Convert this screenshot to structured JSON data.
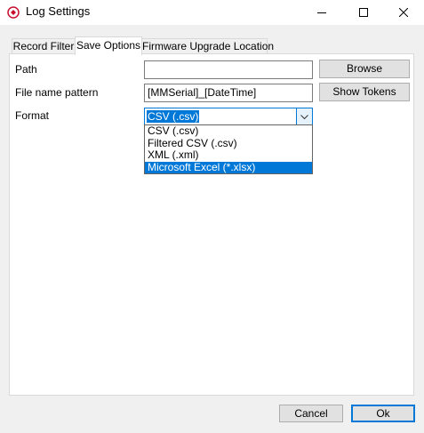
{
  "window": {
    "title": "Log Settings",
    "icon": "app-logo-icon"
  },
  "tabs": [
    {
      "label": "Record Filter",
      "active": false
    },
    {
      "label": "Save Options",
      "active": true
    },
    {
      "label": "Firmware Upgrade Location",
      "active": false
    }
  ],
  "form": {
    "path": {
      "label": "Path",
      "value": "",
      "button": "Browse"
    },
    "pattern": {
      "label": "File name pattern",
      "value": "[MMSerial]_[DateTime]",
      "button": "Show Tokens"
    },
    "format": {
      "label": "Format",
      "selected": "CSV (.csv)",
      "options": [
        "CSV (.csv)",
        "Filtered CSV (.csv)",
        "XML (.xml)",
        "Microsoft Excel (*.xlsx)"
      ],
      "highlighted": "Microsoft Excel (*.xlsx)"
    }
  },
  "footer": {
    "cancel": "Cancel",
    "ok": "Ok"
  },
  "colors": {
    "accent": "#0078d7",
    "panel": "#ffffff",
    "window": "#f0f0f0"
  }
}
